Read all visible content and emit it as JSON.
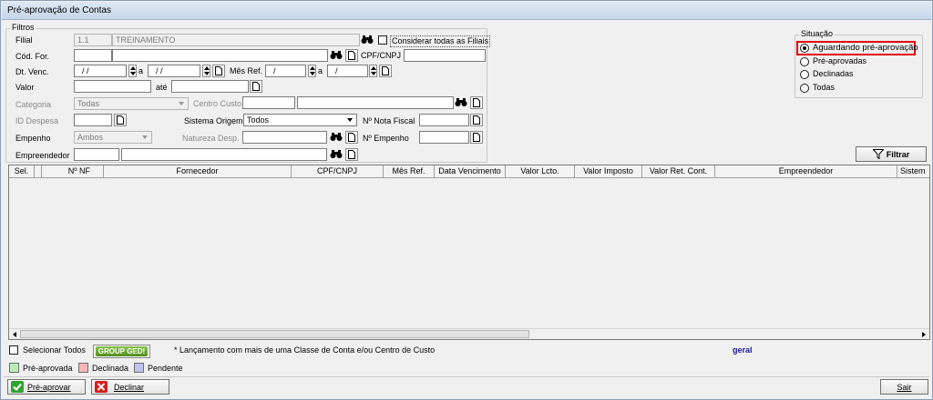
{
  "window": {
    "title": "Pré-aprovação de Contas"
  },
  "filtros": {
    "group_title": "Filtros",
    "filial_label": "Filial",
    "filial_code": "1.1",
    "filial_name": "TREINAMENTO",
    "consider_all_label": "Considerar todas as Filiais",
    "cod_for_label": "Cód. For.",
    "cpf_cnpj_label": "CPF/CNPJ",
    "dt_venc_label": "Dt. Venc.",
    "dt_venc_from": "/ /",
    "dt_venc_to": "/ /",
    "a_label": "a",
    "mes_ref_label": "Mês Ref.",
    "mes_ref_from": "/",
    "mes_ref_to": "/",
    "valor_label": "Valor",
    "ate_label": "até",
    "categoria_label": "Categoria",
    "categoria_value": "Todas",
    "centro_custo_label": "Centro Custo",
    "id_despesa_label": "ID Despesa",
    "sistema_origem_label": "Sistema Origem",
    "sistema_origem_value": "Todos",
    "nota_fiscal_label": "Nº Nota Fiscal",
    "empenho_label": "Empenho",
    "empenho_value": "Ambos",
    "natureza_label": "Natureza Desp.",
    "n_empenho_label": "Nº Empenho",
    "empreendedor_label": "Empreendedor"
  },
  "situacao": {
    "group_title": "Situação",
    "options": [
      {
        "label": "Aguardando pré-aprovação",
        "selected": true
      },
      {
        "label": "Pré-aprovadas",
        "selected": false
      },
      {
        "label": "Declinadas",
        "selected": false
      },
      {
        "label": "Todas",
        "selected": false
      }
    ],
    "highlight_color": "#e00000"
  },
  "filtrar_label": "Filtrar",
  "grid": {
    "columns": [
      "Sel.",
      "",
      "Nº NF",
      "Fornecedor",
      "CPF/CNPJ",
      "Mês Ref.",
      "Data Vencimento",
      "Valor Lcto.",
      "Valor Imposto",
      "Valor Ret. Cont.",
      "Empreendedor",
      "Sistem"
    ]
  },
  "footer": {
    "select_all_label": "Selecionar Todos",
    "group_ged_label": "GROUP GED!",
    "note": "* Lançamento com mais de uma Classe de Conta e/ou Centro de Custo",
    "geral_label": "geral",
    "legend": [
      {
        "label": "Pré-aprovada",
        "color": "#b9f0b9"
      },
      {
        "label": "Declinada",
        "color": "#f4b8b8"
      },
      {
        "label": "Pendente",
        "color": "#c2c2f0"
      }
    ],
    "pre_aprovar_label": "Pré-aprovar",
    "declinar_label": "Declinar",
    "sair_label": "Sair"
  }
}
